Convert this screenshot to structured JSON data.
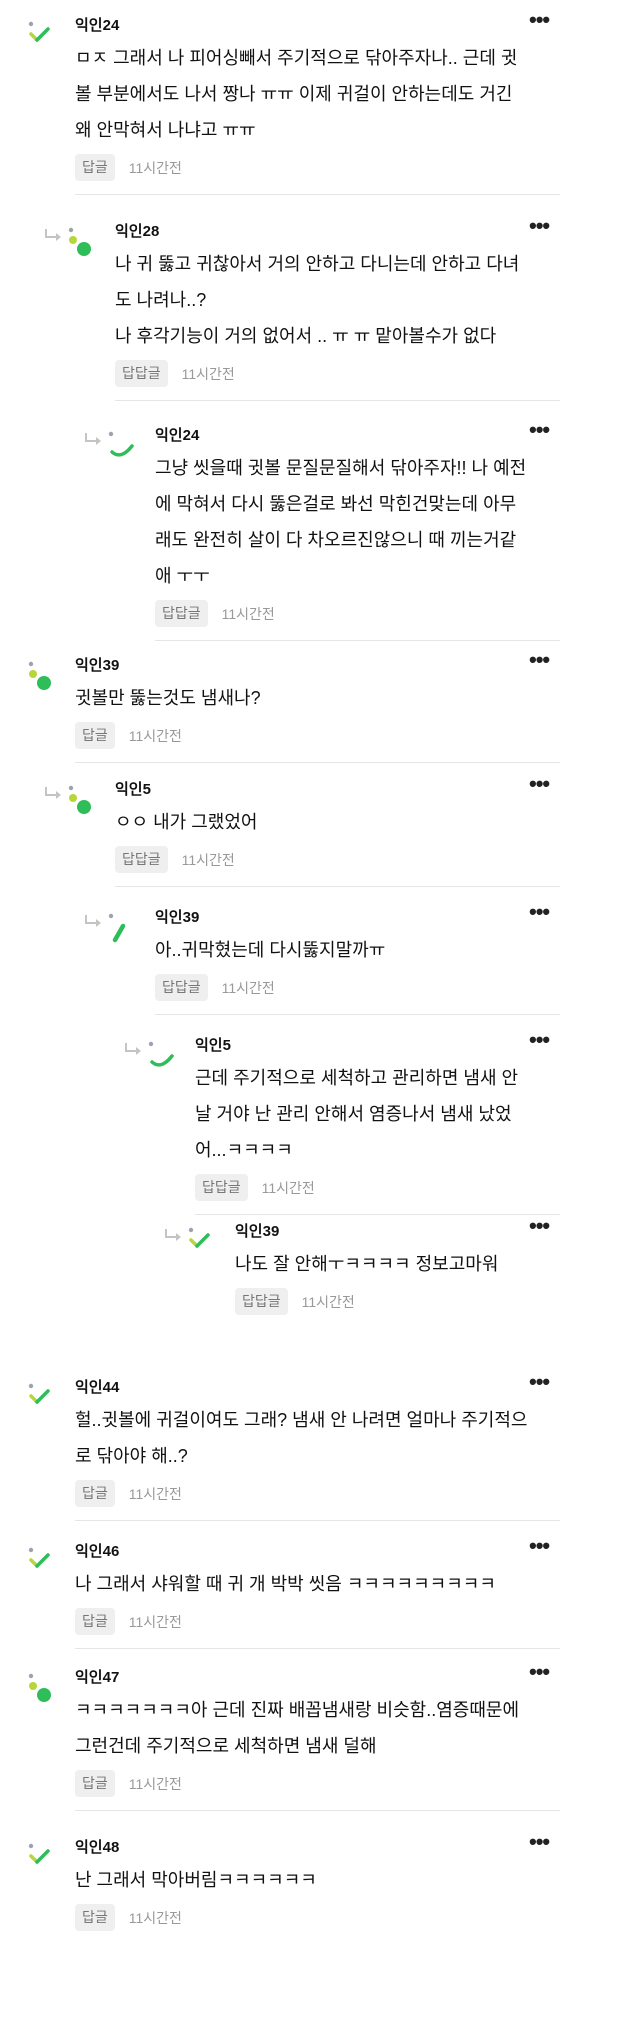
{
  "comments": [
    {
      "author": "익인24",
      "lines": [
        "ㅁㅈ 그래서 나 피어싱빼서 주기적으로 닦아주자나.. 근데 귓",
        "볼 부분에서도 나서 짱나 ㅠㅠ 이제 귀걸이 안하는데도 거긴",
        "왜 안막혀서 나냐고 ㅠㅠ"
      ],
      "reply_label": "답글",
      "time": "11시간전",
      "avatar": "check",
      "depth": 0
    },
    {
      "author": "익인28",
      "lines": [
        "나 귀 뚫고 귀찮아서 거의 안하고 다니는데 안하고 다녀",
        "도 나려나..?",
        "나 후각기능이 거의 없어서 .. ㅠ ㅠ 맡아볼수가 없다"
      ],
      "reply_label": "답답글",
      "time": "11시간전",
      "avatar": "dots",
      "depth": 1
    },
    {
      "author": "익인24",
      "lines": [
        "그냥 씻을때 귓볼 문질문질해서 닦아주자!! 나 예전",
        "에 막혀서 다시 뚫은걸로 봐선 막힌건맞는데 아무",
        "래도 완전히 살이 다 차오르진않으니 때 끼는거같",
        "애 ㅜㅜ"
      ],
      "reply_label": "답답글",
      "time": "11시간전",
      "avatar": "smile",
      "depth": 2
    },
    {
      "author": "익인39",
      "lines": [
        "귓볼만 뚫는것도 냄새나?"
      ],
      "reply_label": "답글",
      "time": "11시간전",
      "avatar": "dots",
      "depth": 0
    },
    {
      "author": "익인5",
      "lines": [
        "ㅇㅇ 내가 그랬었어"
      ],
      "reply_label": "답답글",
      "time": "11시간전",
      "avatar": "dots",
      "depth": 1
    },
    {
      "author": "익인39",
      "lines": [
        "아..귀막혔는데 다시뚫지말까ㅠ"
      ],
      "reply_label": "답답글",
      "time": "11시간전",
      "avatar": "slash",
      "depth": 2
    },
    {
      "author": "익인5",
      "lines": [
        "근데 주기적으로 세척하고 관리하면 냄새 안",
        "날 거야 난 관리 안해서 염증나서 냄새 났었",
        "어...ㅋㅋㅋㅋ"
      ],
      "reply_label": "답답글",
      "time": "11시간전",
      "avatar": "smile",
      "depth": 3
    },
    {
      "author": "익인39",
      "lines": [
        "나도 잘 안해ㅜㅋㅋㅋㅋ 정보고마워"
      ],
      "reply_label": "답답글",
      "time": "11시간전",
      "avatar": "check",
      "depth": 4
    },
    {
      "author": "익인44",
      "lines": [
        "헐..귓볼에 귀걸이여도 그래? 냄새 안 나려면 얼마나 주기적으",
        "로 닦아야 해..?"
      ],
      "reply_label": "답글",
      "time": "11시간전",
      "avatar": "check",
      "depth": 0
    },
    {
      "author": "익인46",
      "lines": [
        "나 그래서 샤워할 때 귀 개 박박 씻음 ㅋㅋㅋㅋㅋㅋㅋㅋㅋ"
      ],
      "reply_label": "답글",
      "time": "11시간전",
      "avatar": "check",
      "depth": 0
    },
    {
      "author": "익인47",
      "lines": [
        "ㅋㅋㅋㅋㅋㅋㅋ아 근데 진짜 배꼽냄새랑 비슷함..염증때문에",
        "그런건데 주기적으로 세척하면 냄새 덜해"
      ],
      "reply_label": "답글",
      "time": "11시간전",
      "avatar": "dots",
      "depth": 0
    },
    {
      "author": "익인48",
      "lines": [
        "난 그래서 막아버림ㅋㅋㅋㅋㅋㅋ"
      ],
      "reply_label": "답글",
      "time": "11시간전",
      "avatar": "check",
      "depth": 0
    }
  ],
  "more_label": "•••",
  "colors": {
    "green": "#2ebd59",
    "lime": "#b6d63a"
  }
}
